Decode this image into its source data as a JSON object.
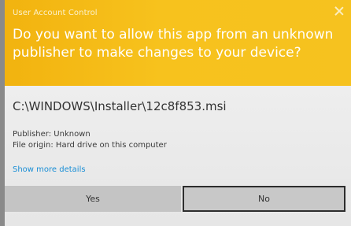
{
  "dialog": {
    "title": "User Account Control",
    "question": "Do you want to allow this app from an unknown publisher to make changes to your device?",
    "program_path": "C:\\WINDOWS\\Installer\\12c8f853.msi",
    "publisher": "Publisher: Unknown",
    "file_origin": "File origin: Hard drive on this computer",
    "show_more_label": "Show more details",
    "yes_label": "Yes",
    "no_label": "No",
    "close_icon": "close-icon"
  },
  "colors": {
    "header": "#f6be18",
    "body": "#e9e9e9",
    "link": "#1a8fd6"
  }
}
